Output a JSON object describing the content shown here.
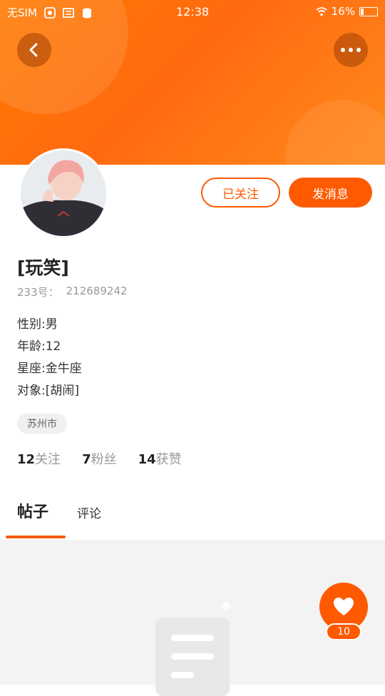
{
  "status_bar": {
    "carrier": "无SIM",
    "time": "12:38",
    "battery": "16%"
  },
  "profile": {
    "name": "[玩笑]",
    "id_label": "233号：",
    "id_value": "212689242",
    "follow_button": "已关注",
    "message_button": "发消息",
    "info": [
      {
        "label": "性别:",
        "value": "男"
      },
      {
        "label": "年龄:",
        "value": "12"
      },
      {
        "label": "星座:",
        "value": "金牛座"
      },
      {
        "label": "对象:",
        "value": "[胡闹]"
      }
    ],
    "location": "苏州市",
    "stats": [
      {
        "num": "12",
        "label": "关注"
      },
      {
        "num": "7",
        "label": "粉丝"
      },
      {
        "num": "14",
        "label": "获赞"
      }
    ]
  },
  "tabs": {
    "active": "帖子",
    "inactive": "评论"
  },
  "like_fab": {
    "count": "10"
  },
  "colors": {
    "accent": "#ff5a00",
    "header_gradient_start": "#ff7a00",
    "header_gradient_end": "#ff8a1c",
    "content_bg": "#f3f3f3"
  },
  "icons": {
    "back": "chevron-left-icon",
    "more": "more-dots-icon",
    "like": "heart-icon",
    "empty": "document-icon"
  }
}
